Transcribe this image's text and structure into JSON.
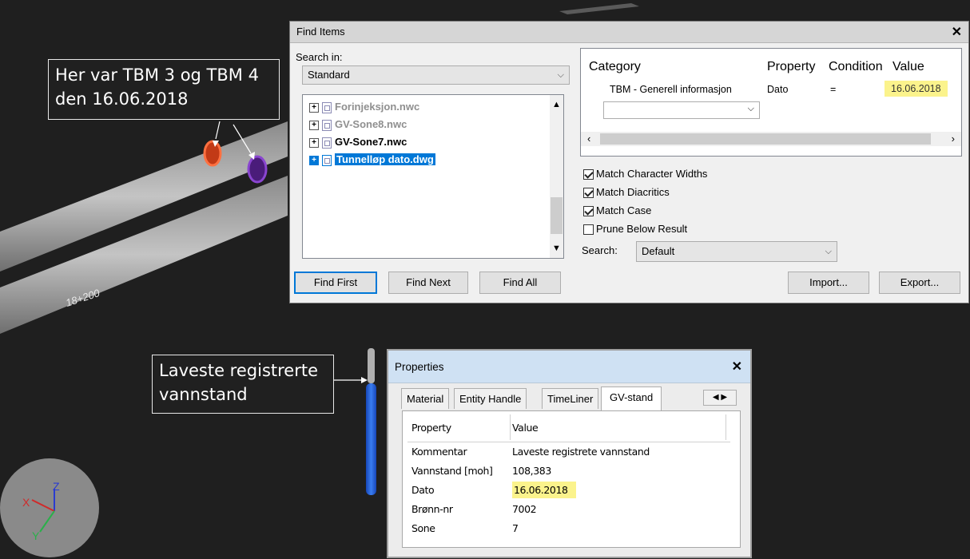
{
  "callouts": {
    "tbm_line1": "Her var TBM 3 og TBM 4",
    "tbm_line2": "den 16.06.2018",
    "water_line1": "Laveste registrerte",
    "water_line2": "vannstand"
  },
  "scene": {
    "chainage_label": "18+200",
    "axis_z": "Z",
    "axis_x": "X",
    "axis_y": "Y"
  },
  "find_items": {
    "title": "Find Items",
    "close": "✕",
    "search_in_label": "Search in:",
    "search_in_value": "Standard",
    "tree": [
      {
        "label": "Forinjeksjon.nwc"
      },
      {
        "label": "GV-Sone8.nwc"
      },
      {
        "label": "GV-Sone7.nwc"
      },
      {
        "label": "Tunnelløp dato.dwg"
      }
    ],
    "grid_headers": {
      "category": "Category",
      "property": "Property",
      "condition": "Condition",
      "value": "Value"
    },
    "grid_row": {
      "category": "TBM - Generell informasjon",
      "property": "Dato",
      "condition": "=",
      "value": "16.06.2018"
    },
    "options": {
      "match_widths": "Match Character Widths",
      "match_diacritics": "Match Diacritics",
      "match_case": "Match Case",
      "prune": "Prune Below Result"
    },
    "search_label": "Search:",
    "search_value": "Default",
    "buttons": {
      "find_first": "Find First",
      "find_next": "Find Next",
      "find_all": "Find All",
      "import": "Import...",
      "export": "Export..."
    }
  },
  "properties": {
    "title": "Properties",
    "close": "✕",
    "tabs": [
      "Material",
      "Entity Handle",
      "TimeLiner",
      "GV-stand"
    ],
    "header_property": "Property",
    "header_value": "Value",
    "rows": [
      {
        "property": "Kommentar",
        "value": "Laveste registrete vannstand"
      },
      {
        "property": "Vannstand [moh]",
        "value": "108,383"
      },
      {
        "property": "Dato",
        "value": "16.06.2018"
      },
      {
        "property": "Brønn-nr",
        "value": "7002"
      },
      {
        "property": "Sone",
        "value": "7"
      }
    ]
  },
  "colors": {
    "highlight": "#fbf38c",
    "selection": "#0078d7",
    "marker_red": "#e0441e",
    "marker_purple": "#7a2fb0",
    "water_pipe": "#1f5fe0"
  }
}
